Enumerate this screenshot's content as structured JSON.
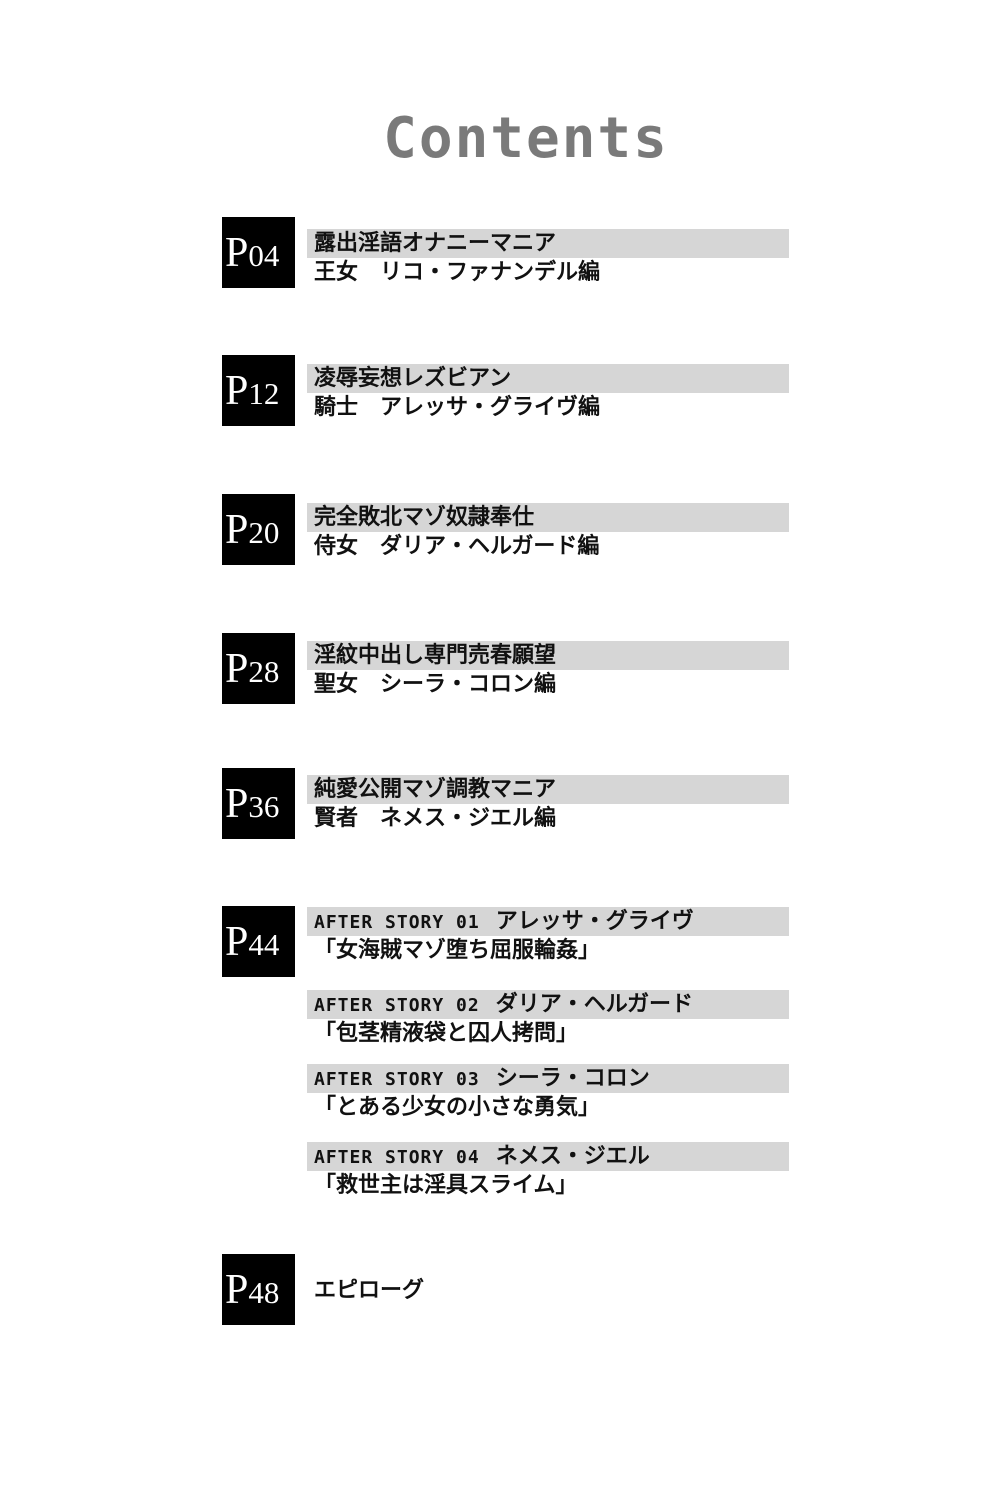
{
  "title": "Contents",
  "page_prefix": "P",
  "chapters": [
    {
      "page": "04",
      "title": "露出淫語オナニーマニア",
      "subtitle": "王女　リコ・ファナンデル編"
    },
    {
      "page": "12",
      "title": "凌辱妄想レズビアン",
      "subtitle": "騎士　アレッサ・グライヴ編"
    },
    {
      "page": "20",
      "title": "完全敗北マゾ奴隷奉仕",
      "subtitle": "侍女　ダリア・ヘルガード編"
    },
    {
      "page": "28",
      "title": "淫紋中出し専門売春願望",
      "subtitle": "聖女　シーラ・コロン編"
    },
    {
      "page": "36",
      "title": "純愛公開マゾ調教マニア",
      "subtitle": "賢者　ネメス・ジエル編"
    }
  ],
  "after_section": {
    "page": "44",
    "stories": [
      {
        "code": "AFTER STORY 01",
        "name": "アレッサ・グライヴ",
        "title": "「女海賊マゾ堕ち屈服輪姦」"
      },
      {
        "code": "AFTER STORY 02",
        "name": "ダリア・ヘルガード",
        "title": "「包茎精液袋と囚人拷問」"
      },
      {
        "code": "AFTER STORY 03",
        "name": "シーラ・コロン",
        "title": "「とある少女の小さな勇気」"
      },
      {
        "code": "AFTER STORY 04",
        "name": "ネメス・ジエル",
        "title": "「救世主は淫具スライム」"
      }
    ]
  },
  "epilogue": {
    "page": "48",
    "title": "エピローグ"
  }
}
